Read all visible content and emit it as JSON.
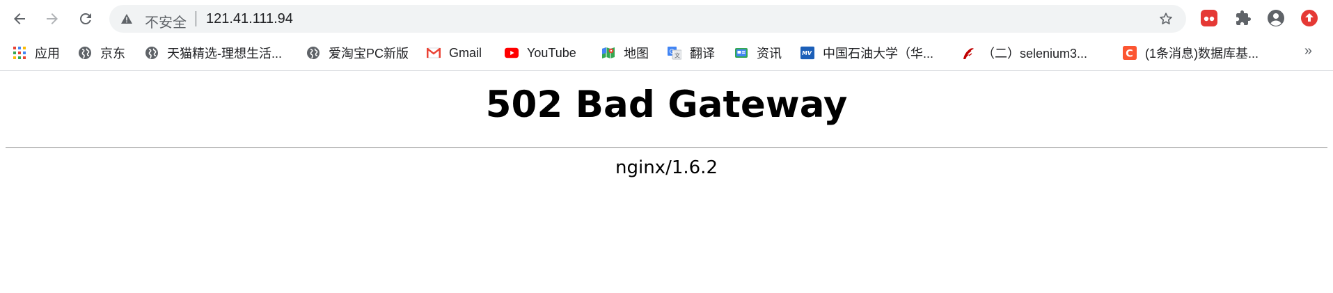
{
  "browser": {
    "security_label": "不安全",
    "url": "121.41.111.94"
  },
  "bookmarks": [
    {
      "label": "应用",
      "icon": "apps-grid-icon"
    },
    {
      "label": "京东",
      "icon": "globe-icon"
    },
    {
      "label": "天猫精选-理想生活...",
      "icon": "globe-icon"
    },
    {
      "label": "爱淘宝PC新版",
      "icon": "globe-icon"
    },
    {
      "label": "Gmail",
      "icon": "gmail-icon"
    },
    {
      "label": "YouTube",
      "icon": "youtube-icon"
    },
    {
      "label": "地图",
      "icon": "maps-icon"
    },
    {
      "label": "翻译",
      "icon": "translate-icon"
    },
    {
      "label": "资讯",
      "icon": "news-icon"
    },
    {
      "label": "中国石油大学（华...",
      "icon": "university-icon"
    },
    {
      "label": "（二）selenium3...",
      "icon": "ruby-icon"
    },
    {
      "label": "(1条消息)数据库基...",
      "icon": "csdn-icon"
    }
  ],
  "page": {
    "title": "502 Bad Gateway",
    "server": "nginx/1.6.2"
  },
  "colors": {
    "youtube": "#ff0000",
    "csdn": "#fc5531",
    "red_extension": "#e53935"
  }
}
